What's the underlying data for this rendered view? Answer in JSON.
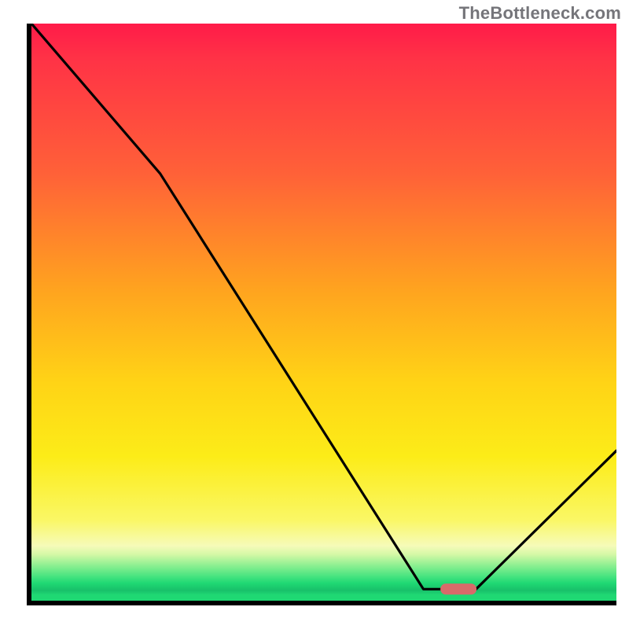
{
  "attribution": "TheBottleneck.com",
  "chart_data": {
    "type": "line",
    "title": "",
    "xlabel": "",
    "ylabel": "",
    "xlim": [
      0,
      100
    ],
    "ylim": [
      0,
      100
    ],
    "background": "gradient red→yellow→green (bottleneck heatmap)",
    "series": [
      {
        "name": "bottleneck-curve",
        "x": [
          0,
          22,
          67,
          70,
          76,
          100
        ],
        "y": [
          100,
          74,
          2,
          2,
          2,
          26
        ]
      }
    ],
    "marker": {
      "x": 73,
      "y": 2,
      "color": "#d86a6a",
      "shape": "pill"
    },
    "colors": {
      "top": "#ff1b49",
      "mid_orange": "#ffa31f",
      "mid_yellow": "#fcec18",
      "green": "#1fd873",
      "axis": "#000000",
      "marker": "#d86a6a",
      "attribution": "#75757a"
    }
  }
}
